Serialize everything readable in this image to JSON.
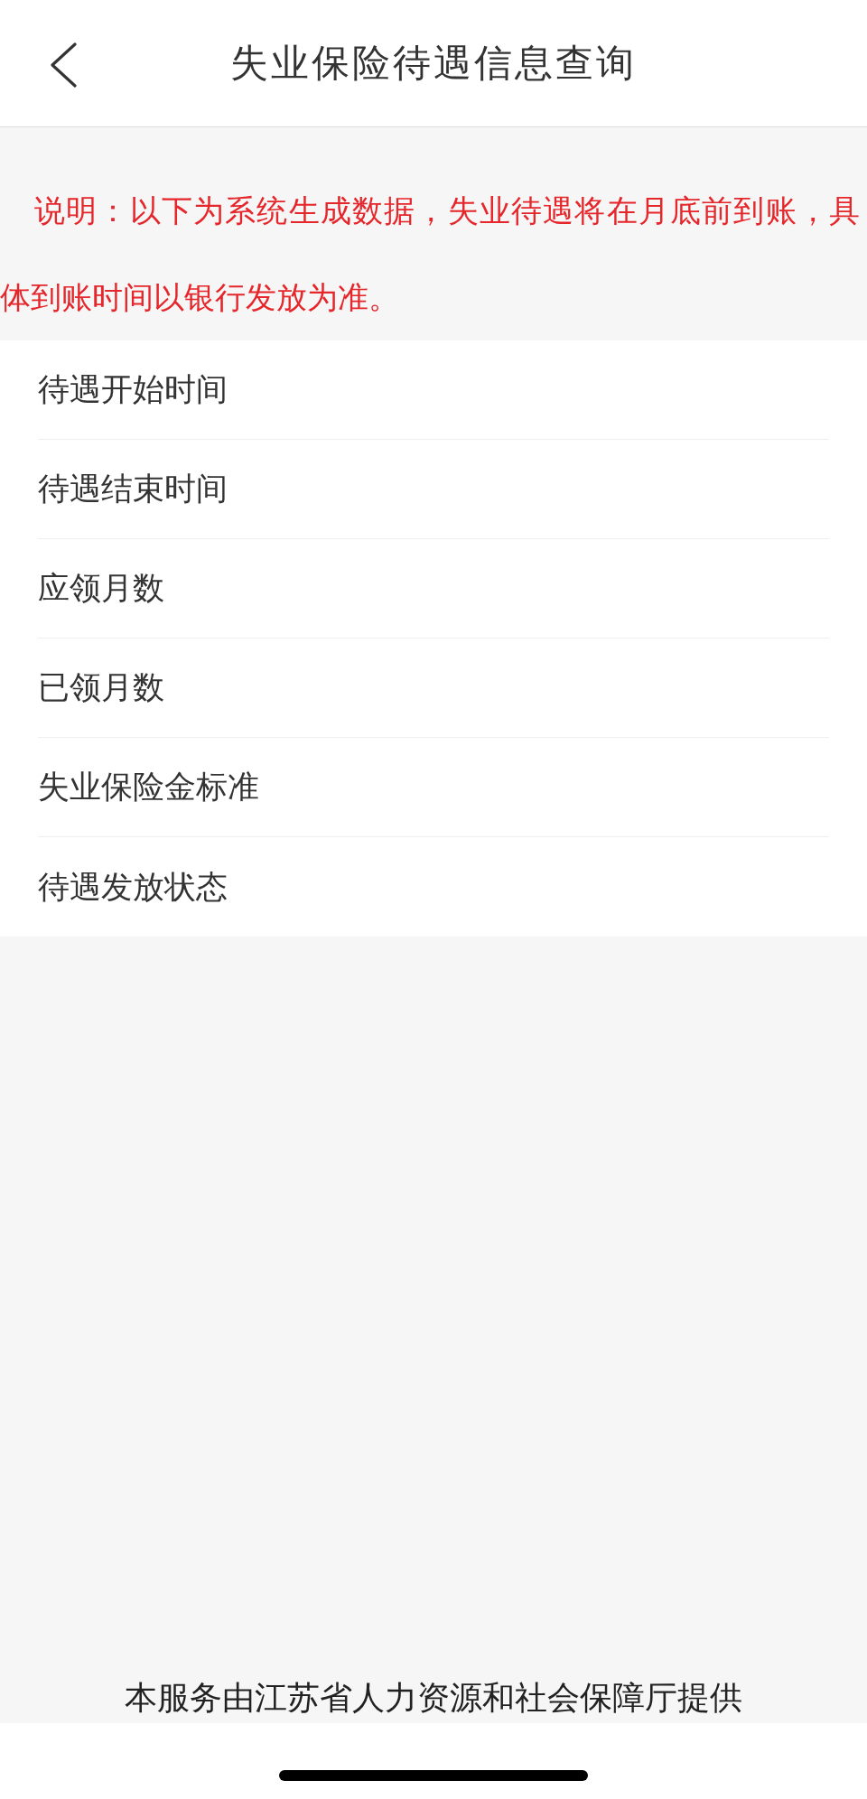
{
  "header": {
    "title": "失业保险待遇信息查询"
  },
  "notice": {
    "text": "说明：以下为系统生成数据，失业待遇将在月底前到账，具体到账时间以银行发放为准。"
  },
  "items": [
    {
      "label": "待遇开始时间"
    },
    {
      "label": "待遇结束时间"
    },
    {
      "label": "应领月数"
    },
    {
      "label": "已领月数"
    },
    {
      "label": "失业保险金标准"
    },
    {
      "label": "待遇发放状态"
    }
  ],
  "footer": {
    "text": "本服务由江苏省人力资源和社会保障厅提供"
  }
}
